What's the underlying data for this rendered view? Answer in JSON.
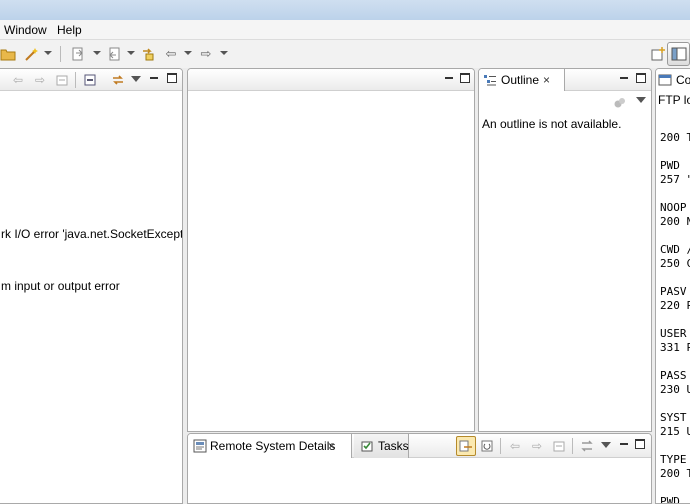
{
  "menu": {
    "window_label": "Window",
    "help_label": "Help"
  },
  "left_view": {
    "lines": [
      "rk I/O error 'java.net.SocketException:",
      "m input or output error"
    ]
  },
  "outline": {
    "tab_label": "Outline",
    "message": "An outline is not available."
  },
  "bottom": {
    "tabs": [
      {
        "label": "Remote System Details"
      },
      {
        "label": "Tasks"
      }
    ]
  },
  "console": {
    "tab_label": "Co",
    "header": "FTP log",
    "lines": [
      "",
      "200 T",
      "",
      "PWD",
      "257 \"",
      "",
      "NOOP",
      "200 N",
      "",
      "CWD /",
      "250 C",
      "",
      "PASV",
      "220 P",
      "",
      "USER",
      "331 P",
      "",
      "PASS",
      "230 U",
      "",
      "SYST",
      "215 U",
      "",
      "TYPE",
      "200 T",
      "",
      "PWD"
    ]
  },
  "icons": {
    "close": "×",
    "back": "⇦",
    "forward": "⇨"
  }
}
